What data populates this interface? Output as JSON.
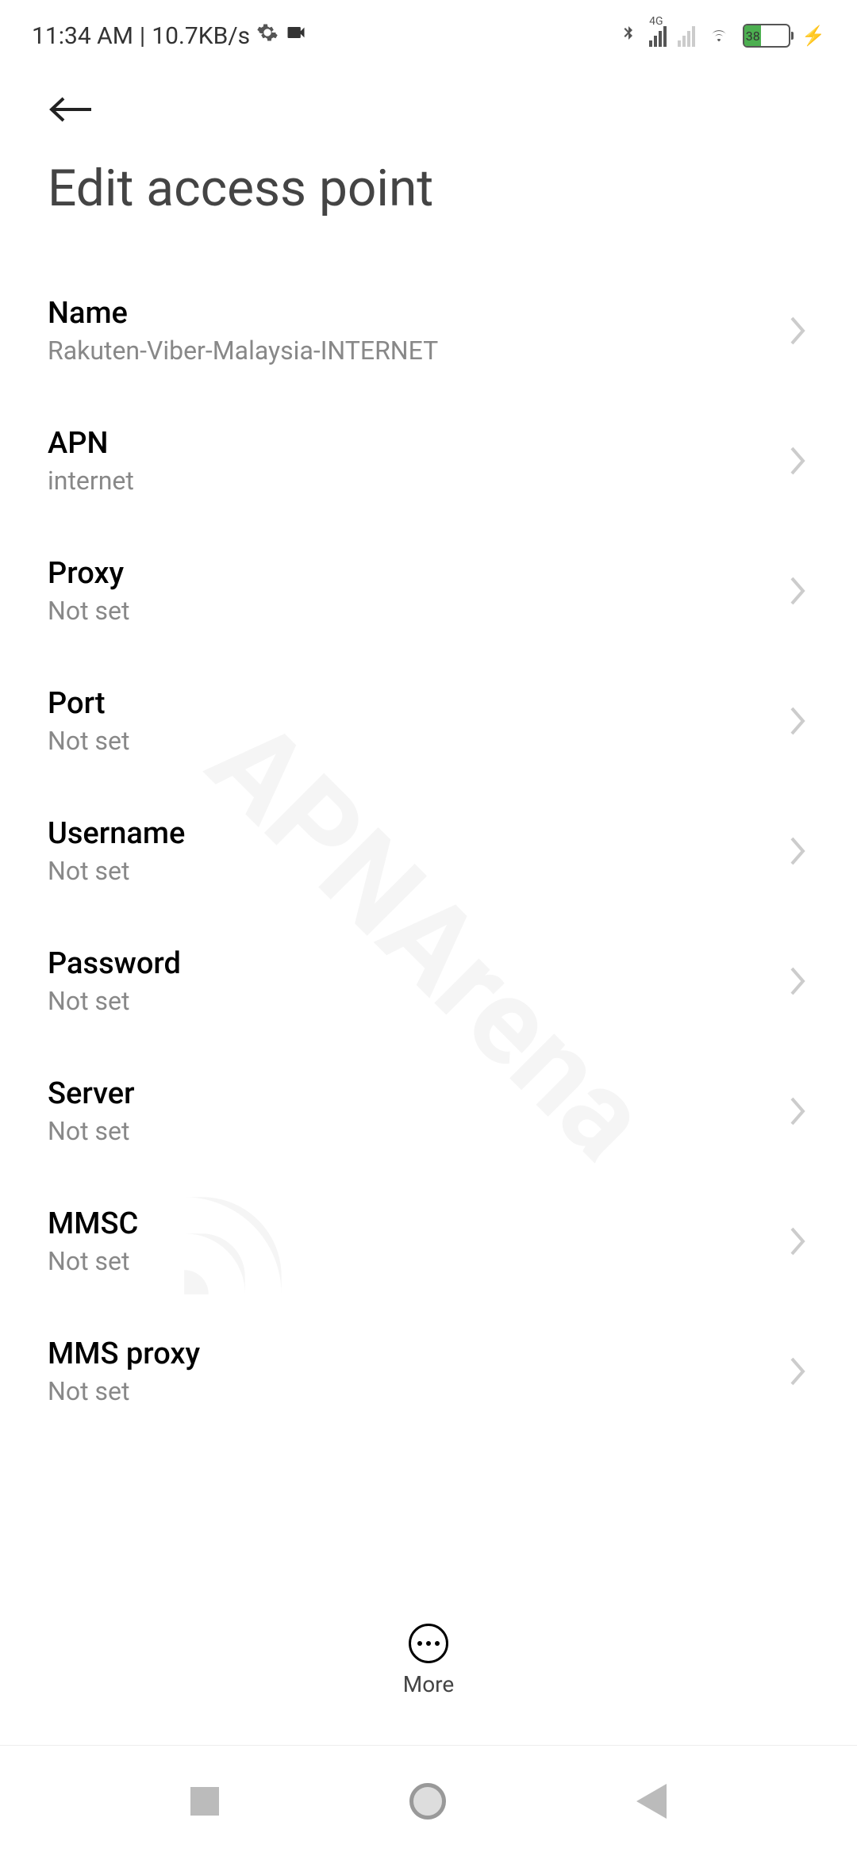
{
  "status_bar": {
    "time": "11:34 AM",
    "separator": "|",
    "data_rate": "10.7KB/s",
    "network_label": "4G",
    "battery_percent": "38"
  },
  "page": {
    "title": "Edit access point"
  },
  "settings": [
    {
      "label": "Name",
      "value": "Rakuten-Viber-Malaysia-INTERNET"
    },
    {
      "label": "APN",
      "value": "internet"
    },
    {
      "label": "Proxy",
      "value": "Not set"
    },
    {
      "label": "Port",
      "value": "Not set"
    },
    {
      "label": "Username",
      "value": "Not set"
    },
    {
      "label": "Password",
      "value": "Not set"
    },
    {
      "label": "Server",
      "value": "Not set"
    },
    {
      "label": "MMSC",
      "value": "Not set"
    },
    {
      "label": "MMS proxy",
      "value": "Not set"
    }
  ],
  "bottom_action": {
    "label": "More"
  },
  "watermark": "APNArena"
}
